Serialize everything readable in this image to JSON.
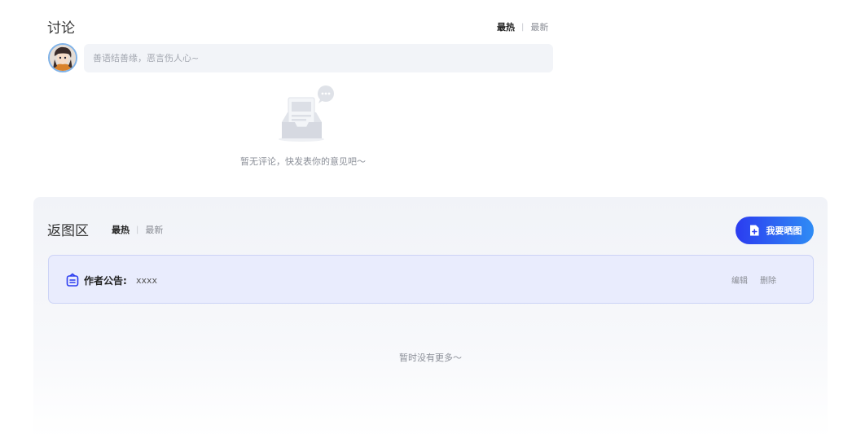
{
  "discussion": {
    "title": "讨论",
    "sort_hot": "最热",
    "sort_sep": "|",
    "sort_new": "最新",
    "comment_placeholder": "善语结善缘，恶言伤人心~",
    "empty_text": "暂无评论，快发表你的意见吧～"
  },
  "gallery": {
    "title": "返图区",
    "sort_hot": "最热",
    "sort_sep": "|",
    "sort_new": "最新",
    "post_button_label": "我要晒图",
    "notice": {
      "label": "作者公告:",
      "content": "xxxx",
      "edit_label": "编辑",
      "delete_label": "删除"
    },
    "no_more_text": "暂时没有更多～"
  },
  "colors": {
    "accent_start": "#2b3cf0",
    "accent_end": "#2f8cf5",
    "notice_bg": "#e9ecfd"
  },
  "icons": {
    "avatar": "user-avatar",
    "empty": "empty-inbox-icon",
    "post": "add-image-icon",
    "notice": "notice-icon"
  }
}
